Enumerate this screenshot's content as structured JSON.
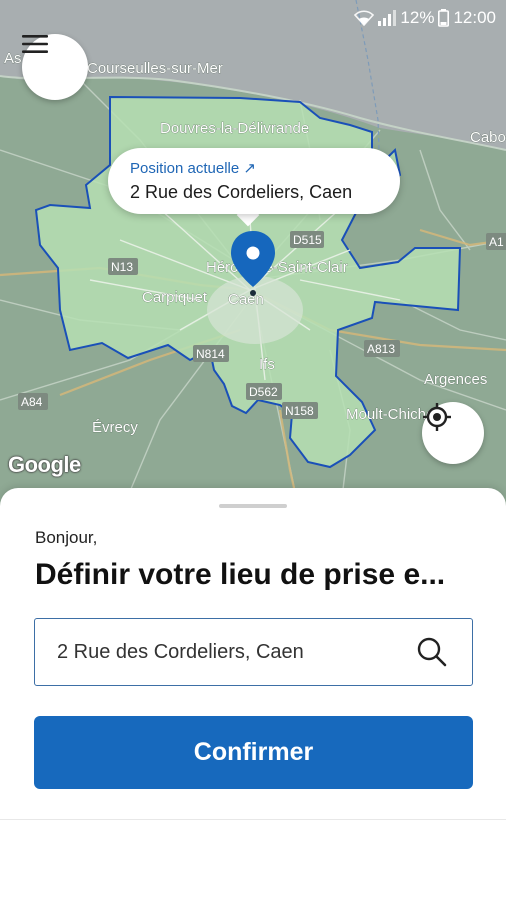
{
  "status_bar": {
    "battery": "12%",
    "time": "12:00"
  },
  "map": {
    "places": [
      {
        "name": "Courseulles-sur-Mer"
      },
      {
        "name": "Douvres-la-Délivrande"
      },
      {
        "name": "Hérouville-Saint-Clair"
      },
      {
        "name": "Carpiquet"
      },
      {
        "name": "Caen"
      },
      {
        "name": "Ifs"
      },
      {
        "name": "Argences"
      },
      {
        "name": "Moult-Chicheboville"
      },
      {
        "name": "Évrecy"
      },
      {
        "name": "Cabo"
      },
      {
        "name": "As"
      }
    ],
    "roads": [
      "D515",
      "N13",
      "N814",
      "A813",
      "D562",
      "N158",
      "A84",
      "A1"
    ],
    "attribution": "Google"
  },
  "location_bubble": {
    "title": "Position actuelle ↗",
    "address": "2 Rue des Cordeliers, Caen"
  },
  "sheet": {
    "greeting": "Bonjour,",
    "heading": "Définir votre lieu de prise e...",
    "search_value": "2 Rue des Cordeliers, Caen",
    "confirm_label": "Confirmer"
  },
  "colors": {
    "accent": "#1769bd",
    "zone_border": "#1a50b8",
    "zone_fill": "#b6dfb3"
  },
  "icons": {
    "menu": "menu-icon",
    "locate": "crosshair-icon",
    "search": "search-icon",
    "pin": "location-pin-icon"
  }
}
